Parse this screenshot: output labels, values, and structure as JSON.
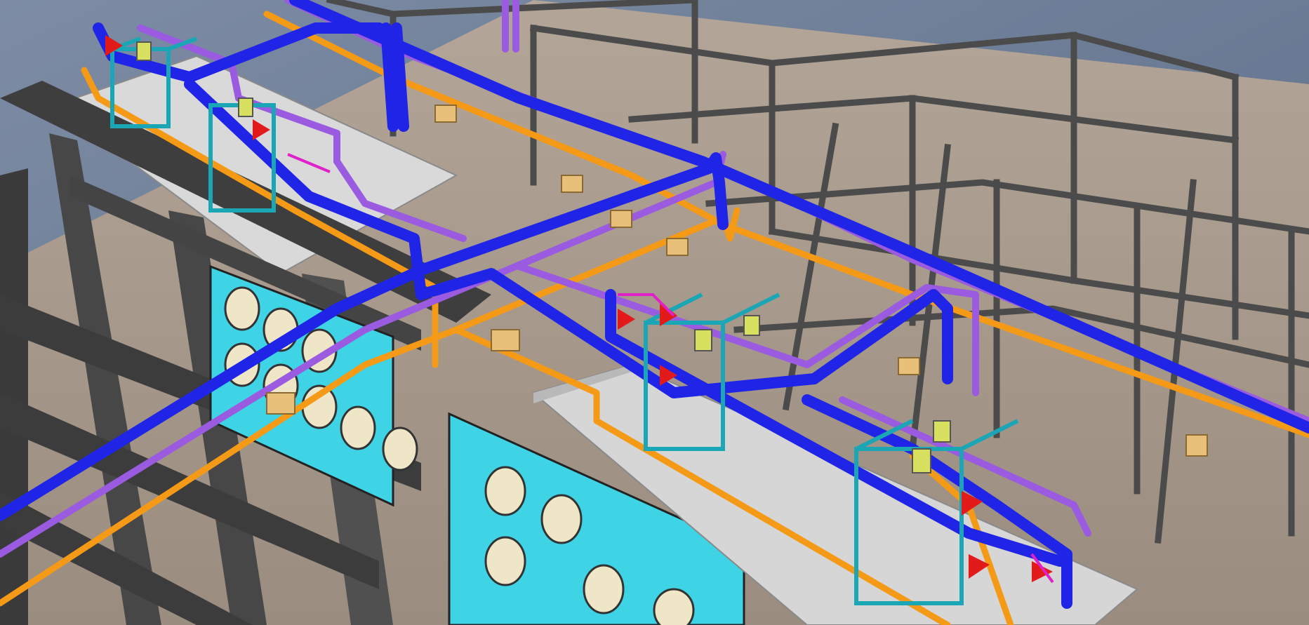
{
  "scene": {
    "kind": "3d-cad-render",
    "subject": "industrial-piping-skid-with-steel-frame",
    "colors": {
      "sky_top": "#7a8aa2",
      "sky_bottom": "#566883",
      "floor": "#a79a8d",
      "floor_dark": "#8f8377",
      "steel": "#4a4a4a",
      "steel_light": "#6c6c6c",
      "platform": "#dcdcdc",
      "panel_cyan": "#3fd3e6",
      "fan_face": "#efe6c8",
      "pipe_blue": "#1f24e6",
      "pipe_purple": "#9a5be0",
      "pipe_orange": "#f59a16",
      "valve_red": "#e21a1a",
      "valve_yellow": "#d8e060",
      "skid_frame": "#1aa6b5",
      "support_block": "#e8c07a",
      "magenta": "#e020c8"
    }
  }
}
